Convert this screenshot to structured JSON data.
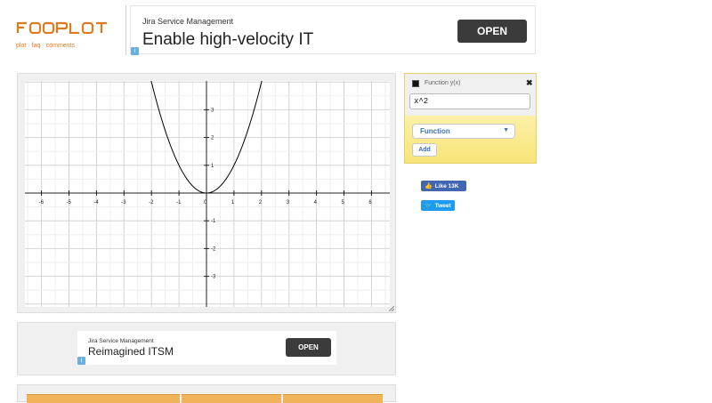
{
  "header": {
    "logo_text": "FOOPLOT",
    "nav": [
      {
        "label": "plot"
      },
      {
        "label": "faq"
      },
      {
        "label": "comments"
      }
    ],
    "nav_separator": "·"
  },
  "top_ad": {
    "sponsor": "Jira Service Management",
    "headline": "Enable high-velocity IT",
    "button_label": "OPEN",
    "adchoice_icon": "info-icon"
  },
  "plot": {
    "function_expression": "x^2",
    "x_tick_labels": [
      "-6",
      "-5",
      "-4",
      "-3",
      "-2",
      "-1",
      "0",
      "1",
      "2",
      "3",
      "4",
      "5",
      "6"
    ],
    "y_tick_labels": [
      "3",
      "2",
      "1",
      "-1",
      "-2",
      "-3"
    ],
    "curve_color": "#000000"
  },
  "function_panel": {
    "title": "Function y(x)",
    "close_icon": "close-icon",
    "input_value": "x^2",
    "type_select": "Function",
    "add_label": "Add",
    "swatch_color": "#111111"
  },
  "social": {
    "like_label": "Like 13K",
    "tweet_label": "Tweet"
  },
  "bottom_ad": {
    "sponsor": "Jira Service Management",
    "headline": "Reimagined ITSM",
    "button_label": "OPEN"
  },
  "colors": {
    "brand_orange": "#e07a1f",
    "panel_yellow": "#f8e478",
    "button_dark": "#3b3b3b",
    "facebook_blue": "#4267b2",
    "twitter_blue": "#1d9bf0"
  }
}
